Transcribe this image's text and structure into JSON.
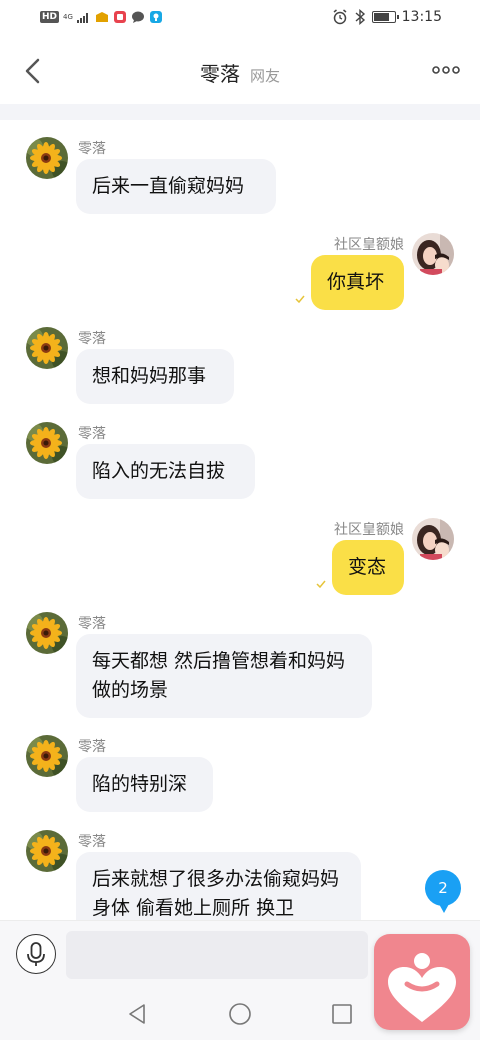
{
  "status_bar": {
    "hd": "HD",
    "network": "4G",
    "time": "13:15",
    "battery_level": 0.8
  },
  "header": {
    "title": "零落",
    "subtitle": "网友"
  },
  "messages": [
    {
      "side": "left",
      "name": "零落",
      "text": "后来一直偷窥妈妈"
    },
    {
      "side": "right",
      "name": "社区皇额娘",
      "text": "你真坏"
    },
    {
      "side": "left",
      "name": "零落",
      "text": "想和妈妈那事"
    },
    {
      "side": "left",
      "name": "零落",
      "text": "陷入的无法自拔"
    },
    {
      "side": "right",
      "name": "社区皇额娘",
      "text": "变态"
    },
    {
      "side": "left",
      "name": "零落",
      "text": "每天都想  然后撸管想着和妈妈做的场景"
    },
    {
      "side": "left",
      "name": "零落",
      "text": "陷的特别深"
    },
    {
      "side": "left",
      "name": "零落",
      "text": "后来就想了很多办法偷窥妈妈身体  偷看她上厕所  换卫"
    }
  ],
  "unread_count": "2",
  "input": {
    "placeholder": ""
  },
  "colors": {
    "accent": "#fadf47",
    "left_bubble": "#f2f3f7",
    "badge": "#1aa0f4",
    "fab": "#f0868e"
  },
  "icons": [
    "back-arrow-icon",
    "more-icon",
    "mic-icon",
    "nav-back-icon",
    "nav-home-icon",
    "nav-recent-icon",
    "heart-app-icon",
    "read-check-icon"
  ]
}
